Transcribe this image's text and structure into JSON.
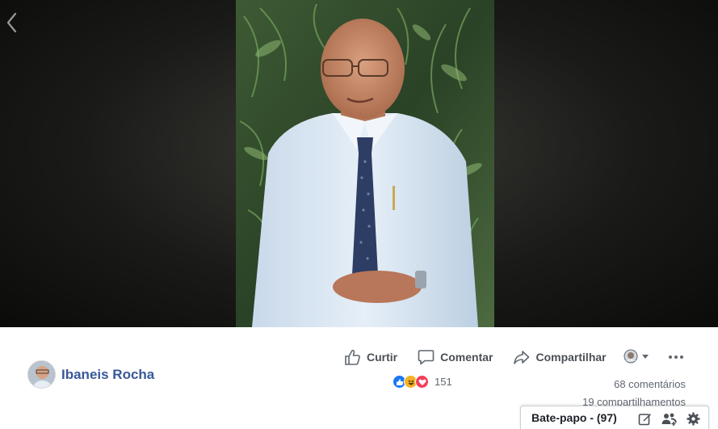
{
  "post": {
    "author_name": "Ibaneis Rocha"
  },
  "actions": {
    "like_label": "Curtir",
    "comment_label": "Comentar",
    "share_label": "Compartilhar"
  },
  "reactions": {
    "types": [
      "like",
      "haha",
      "love"
    ],
    "count": "151"
  },
  "stats": {
    "comments": "68 comentários",
    "shares": "19 compartilhamentos"
  },
  "chat": {
    "label": "Bate-papo",
    "count_text": "(97)",
    "full_label": "Bate-papo - (97)"
  },
  "icons": {
    "back": "chevron-left-icon",
    "like": "thumbs-up-icon",
    "comment": "speech-bubble-icon",
    "share": "share-arrow-icon",
    "audience": "globe-icon",
    "more": "more-dots-icon",
    "compose": "compose-icon",
    "group": "add-group-icon",
    "settings": "gear-icon"
  },
  "colors": {
    "author_link": "#385898",
    "action_text": "#4b4f56",
    "meta_text": "#606770",
    "like_blue": "#1877f2",
    "love_red": "#f33e58",
    "haha_yellow": "#f7b125"
  }
}
